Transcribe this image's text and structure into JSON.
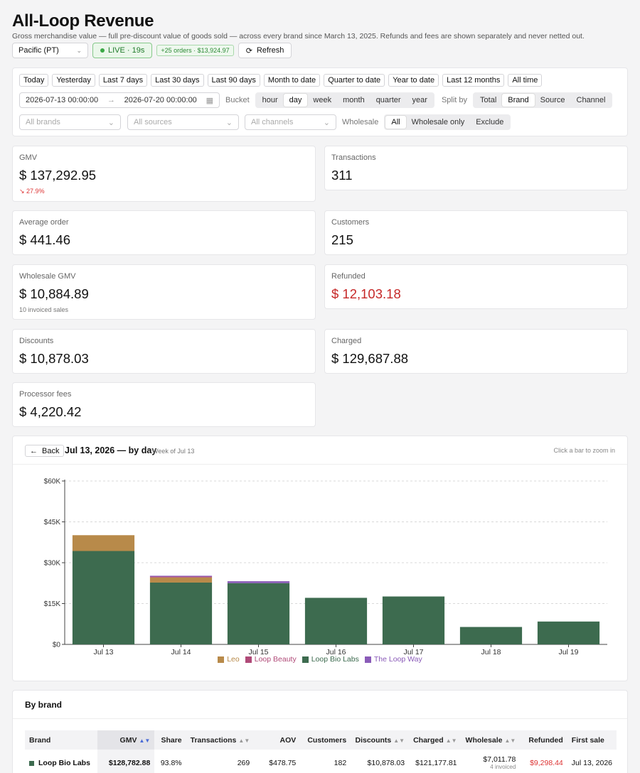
{
  "header": {
    "title": "All-Loop Revenue",
    "subtitle": "Gross merchandise value — full pre-discount value of goods sold — across every brand since March 13, 2025. Refunds and fees are shown separately and never netted out.",
    "timezone": "Pacific (PT)",
    "live_label": "LIVE · 19s",
    "new_orders": "+25 orders · $13,924.97",
    "refresh_label": "Refresh"
  },
  "filters": {
    "presets": [
      "Today",
      "Yesterday",
      "Last 7 days",
      "Last 30 days",
      "Last 90 days",
      "Month to date",
      "Quarter to date",
      "Year to date",
      "Last 12 months",
      "All time"
    ],
    "date_from": "2026-07-13 00:00:00",
    "date_to": "2026-07-20 00:00:00",
    "bucket_label": "Bucket",
    "buckets": [
      "hour",
      "day",
      "week",
      "month",
      "quarter",
      "year"
    ],
    "bucket_selected": "day",
    "split_label": "Split by",
    "splits": [
      "Total",
      "Brand",
      "Source",
      "Channel"
    ],
    "split_selected": "Brand",
    "brands_placeholder": "All brands",
    "sources_placeholder": "All sources",
    "channels_placeholder": "All channels",
    "wholesale_label": "Wholesale",
    "wholesale_options": [
      "All",
      "Wholesale only",
      "Exclude"
    ],
    "wholesale_selected": "All"
  },
  "kpis": {
    "gmv": {
      "label": "GMV",
      "value": "$ 137,292.95",
      "change": "27.9%"
    },
    "transactions": {
      "label": "Transactions",
      "value": "311"
    },
    "avg_order": {
      "label": "Average order",
      "value": "$ 441.46"
    },
    "customers": {
      "label": "Customers",
      "value": "215"
    },
    "wholesale": {
      "label": "Wholesale GMV",
      "value": "$ 10,884.89",
      "sub": "10 invoiced sales"
    },
    "refunded": {
      "label": "Refunded",
      "value": "$ 12,103.18"
    },
    "discounts": {
      "label": "Discounts",
      "value": "$ 10,878.03"
    },
    "charged": {
      "label": "Charged",
      "value": "$ 129,687.88"
    },
    "fees": {
      "label": "Processor fees",
      "value": "$ 4,220.42"
    }
  },
  "chart_header": {
    "back_label": "Back",
    "title": "Jul 13, 2026 — by day",
    "subtitle": "Week of Jul 13",
    "hint": "Click a bar to zoom in"
  },
  "colors": {
    "leo": "#b88a4a",
    "loop_beauty": "#b04a78",
    "loop_bio_labs": "#3d6b4f",
    "the_loop_way": "#8a5bb8"
  },
  "chart_data": {
    "type": "bar",
    "stacked": true,
    "categories": [
      "Jul 13",
      "Jul 14",
      "Jul 15",
      "Jul 16",
      "Jul 17",
      "Jul 18",
      "Jul 19"
    ],
    "series": [
      {
        "name": "Loop Bio Labs",
        "values": [
          34300,
          22700,
          22500,
          17100,
          17600,
          6400,
          8400
        ]
      },
      {
        "name": "Leo",
        "values": [
          5800,
          1900,
          0,
          0,
          0,
          0,
          0
        ]
      },
      {
        "name": "Loop Beauty",
        "values": [
          0,
          300,
          0,
          0,
          0,
          0,
          0
        ]
      },
      {
        "name": "The Loop Way",
        "values": [
          0,
          300,
          700,
          0,
          0,
          0,
          0
        ]
      }
    ],
    "legend_order": [
      "Leo",
      "Loop Beauty",
      "Loop Bio Labs",
      "The Loop Way"
    ],
    "y_ticks": [
      "$0",
      "$15K",
      "$30K",
      "$45K",
      "$60K"
    ],
    "ylim": [
      0,
      60000
    ],
    "grid": true,
    "legend_position": "bottom"
  },
  "brand_table": {
    "title": "By brand",
    "columns": [
      "Brand",
      "GMV",
      "Share",
      "Transactions",
      "AOV",
      "Customers",
      "Discounts",
      "Charged",
      "Wholesale",
      "Refunded",
      "First sale"
    ],
    "rows": [
      {
        "brand": "Loop Bio Labs",
        "gmv": "$128,782.88",
        "share": "93.8%",
        "transactions": "269",
        "aov": "$478.75",
        "customers": "182",
        "discounts": "$10,878.03",
        "charged": "$121,177.81",
        "wholesale": "$7,011.78",
        "wholesale_sub": "4 invoiced",
        "refunded": "$9,298.44",
        "first_sale": "Jul 13, 2026"
      }
    ]
  }
}
